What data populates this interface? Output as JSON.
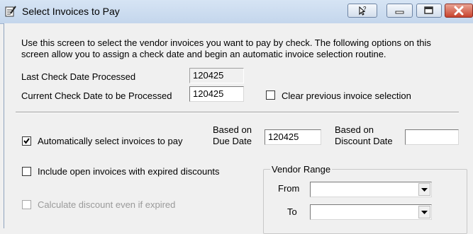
{
  "window": {
    "title": "Select Invoices to Pay"
  },
  "description": "Use this screen to select the vendor invoices you want to pay by check. The following options on this screen allow you to assign a check date and begin an automatic invoice selection routine.",
  "last_check": {
    "label": "Last Check Date Processed",
    "value": "120425"
  },
  "current_check": {
    "label": "Current Check Date to be Processed",
    "value": "120425"
  },
  "clear_previous": {
    "label": "Clear previous invoice selection",
    "checked": false
  },
  "auto_select": {
    "label": "Automatically select invoices to pay",
    "checked": true
  },
  "due_date": {
    "label_line1": "Based on",
    "label_line2": "Due Date",
    "value": "120425"
  },
  "discount_date": {
    "label_line1": "Based on",
    "label_line2": "Discount Date",
    "value": ""
  },
  "include_open": {
    "label": "Include open invoices with expired discounts",
    "checked": false
  },
  "calc_discount": {
    "label": "Calculate discount even if expired",
    "checked": false,
    "disabled": true
  },
  "vendor_range": {
    "title": "Vendor Range",
    "from_label": "From",
    "from_value": "",
    "to_label": "To",
    "to_value": ""
  },
  "icons": {
    "app": "notepad-pen-icon",
    "help": "help-pointer-icon",
    "minimize": "minimize-icon",
    "maximize": "maximize-icon",
    "close": "close-icon"
  },
  "colors": {
    "titlebar": "#c4d6ec",
    "close_button": "#c8432d"
  }
}
